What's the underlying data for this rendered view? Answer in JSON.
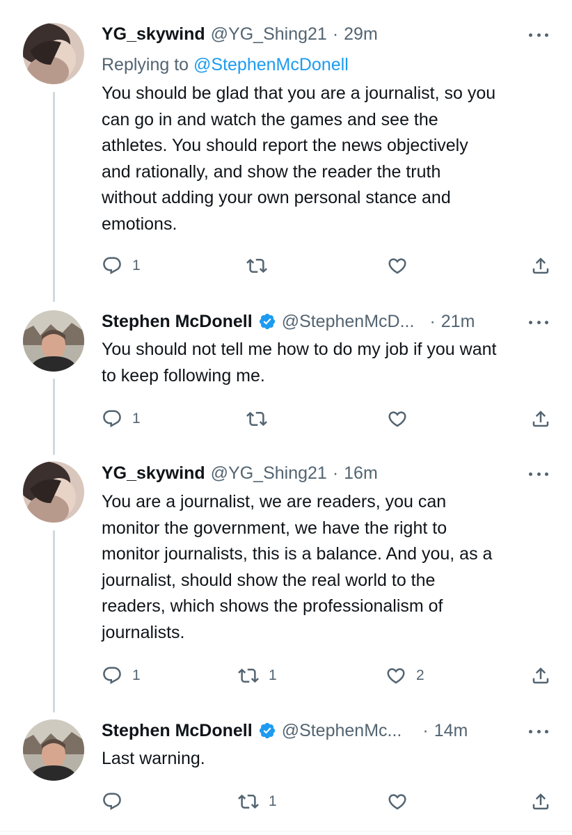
{
  "tweets": [
    {
      "name": "YG_skywind",
      "handle": "@YG_Shing21",
      "dot": "·",
      "time": "29m",
      "reply_prefix": "Replying to ",
      "reply_mention": "@StephenMcDonell",
      "text": "You should be glad that you are a journalist, so you\ncan go in and watch the games and see the\nathletes. You should report the news objectively\nand rationally, and show the reader the truth\nwithout adding your own personal stance and\nemotions.",
      "reply_count": "1",
      "retweet_count": "",
      "like_count": ""
    },
    {
      "name": "Stephen McDonell",
      "handle": "@StephenMcD...",
      "dot": "·",
      "time": "21m",
      "verified": true,
      "text": "You should not tell me how to do my job if you want\nto keep following me.",
      "reply_count": "1",
      "retweet_count": "",
      "like_count": ""
    },
    {
      "name": "YG_skywind",
      "handle": "@YG_Shing21",
      "dot": "·",
      "time": "16m",
      "text": "You are a journalist, we are readers, you can\nmonitor the government, we have the right to\nmonitor journalists, this is a balance. And you, as a\njournalist, should show the real world to the\nreaders, which shows the professionalism of\njournalists.",
      "reply_count": "1",
      "retweet_count": "1",
      "like_count": "2"
    },
    {
      "name": "Stephen McDonell",
      "handle": "@StephenMc...",
      "dot": "·",
      "time": "14m",
      "verified": true,
      "text": "Last warning.",
      "reply_count": "",
      "retweet_count": "1",
      "like_count": ""
    }
  ],
  "icons": {
    "reply": "reply-icon",
    "retweet": "retweet-icon",
    "like": "heart-icon",
    "share": "share-icon",
    "more": "more-icon",
    "verified": "verified-badge-icon"
  },
  "colors": {
    "text": "#0f1419",
    "secondary": "#536471",
    "link": "#1d9bf0",
    "verified": "#1d9bf0",
    "thread_line": "#cfd9de"
  }
}
